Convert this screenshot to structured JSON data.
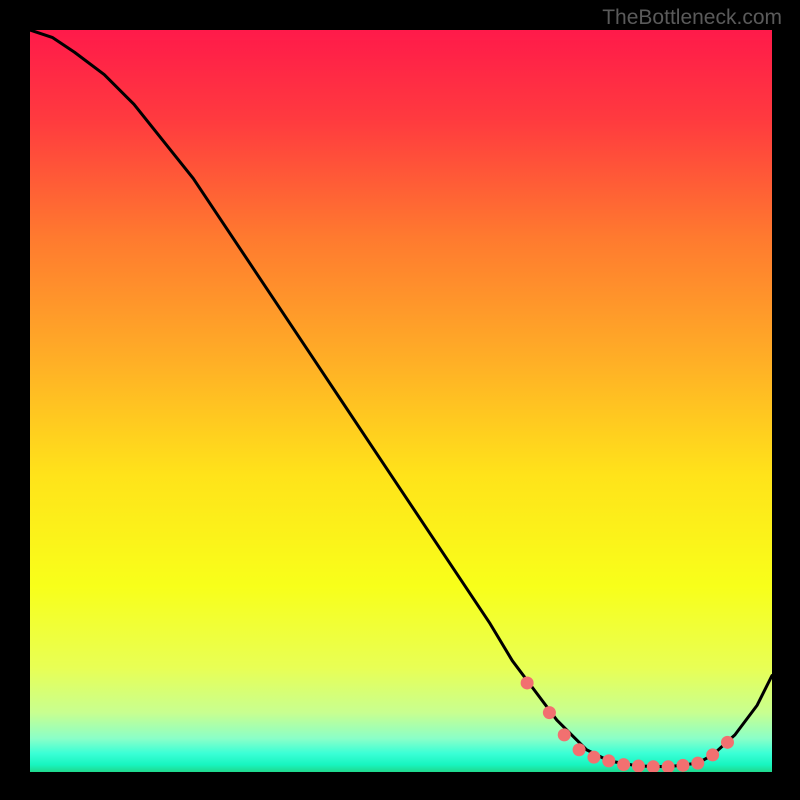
{
  "watermark": "TheBottleneck.com",
  "chart_data": {
    "type": "line",
    "title": "",
    "xlabel": "",
    "ylabel": "",
    "xlim": [
      0,
      100
    ],
    "ylim": [
      0,
      100
    ],
    "curve": {
      "x": [
        0,
        3,
        6,
        10,
        14,
        18,
        22,
        26,
        30,
        34,
        38,
        42,
        46,
        50,
        54,
        58,
        62,
        65,
        68,
        71,
        73,
        75,
        78,
        82,
        86,
        90,
        92,
        95,
        98,
        100
      ],
      "y": [
        100,
        99,
        97,
        94,
        90,
        85,
        80,
        74,
        68,
        62,
        56,
        50,
        44,
        38,
        32,
        26,
        20,
        15,
        11,
        7,
        5,
        3,
        1.5,
        0.8,
        0.7,
        1.2,
        2.3,
        5,
        9,
        13
      ]
    },
    "markers": {
      "x": [
        67,
        70,
        72,
        74,
        76,
        78,
        80,
        82,
        84,
        86,
        88,
        90,
        92,
        94
      ],
      "y": [
        12,
        8,
        5,
        3,
        2,
        1.5,
        1,
        0.8,
        0.7,
        0.7,
        0.9,
        1.2,
        2.3,
        4
      ]
    },
    "gradient_stops": [
      {
        "offset": 0,
        "color": "#ff1a4a"
      },
      {
        "offset": 0.12,
        "color": "#ff3a3f"
      },
      {
        "offset": 0.28,
        "color": "#ff7a2f"
      },
      {
        "offset": 0.45,
        "color": "#ffb026"
      },
      {
        "offset": 0.6,
        "color": "#ffe31a"
      },
      {
        "offset": 0.75,
        "color": "#f8ff1a"
      },
      {
        "offset": 0.86,
        "color": "#e8ff55"
      },
      {
        "offset": 0.92,
        "color": "#c8ff90"
      },
      {
        "offset": 0.955,
        "color": "#8affc8"
      },
      {
        "offset": 0.975,
        "color": "#3affd6"
      },
      {
        "offset": 0.99,
        "color": "#18f5c0"
      },
      {
        "offset": 1.0,
        "color": "#20d88c"
      }
    ],
    "marker_color": "#f27070",
    "line_color": "#000000"
  }
}
